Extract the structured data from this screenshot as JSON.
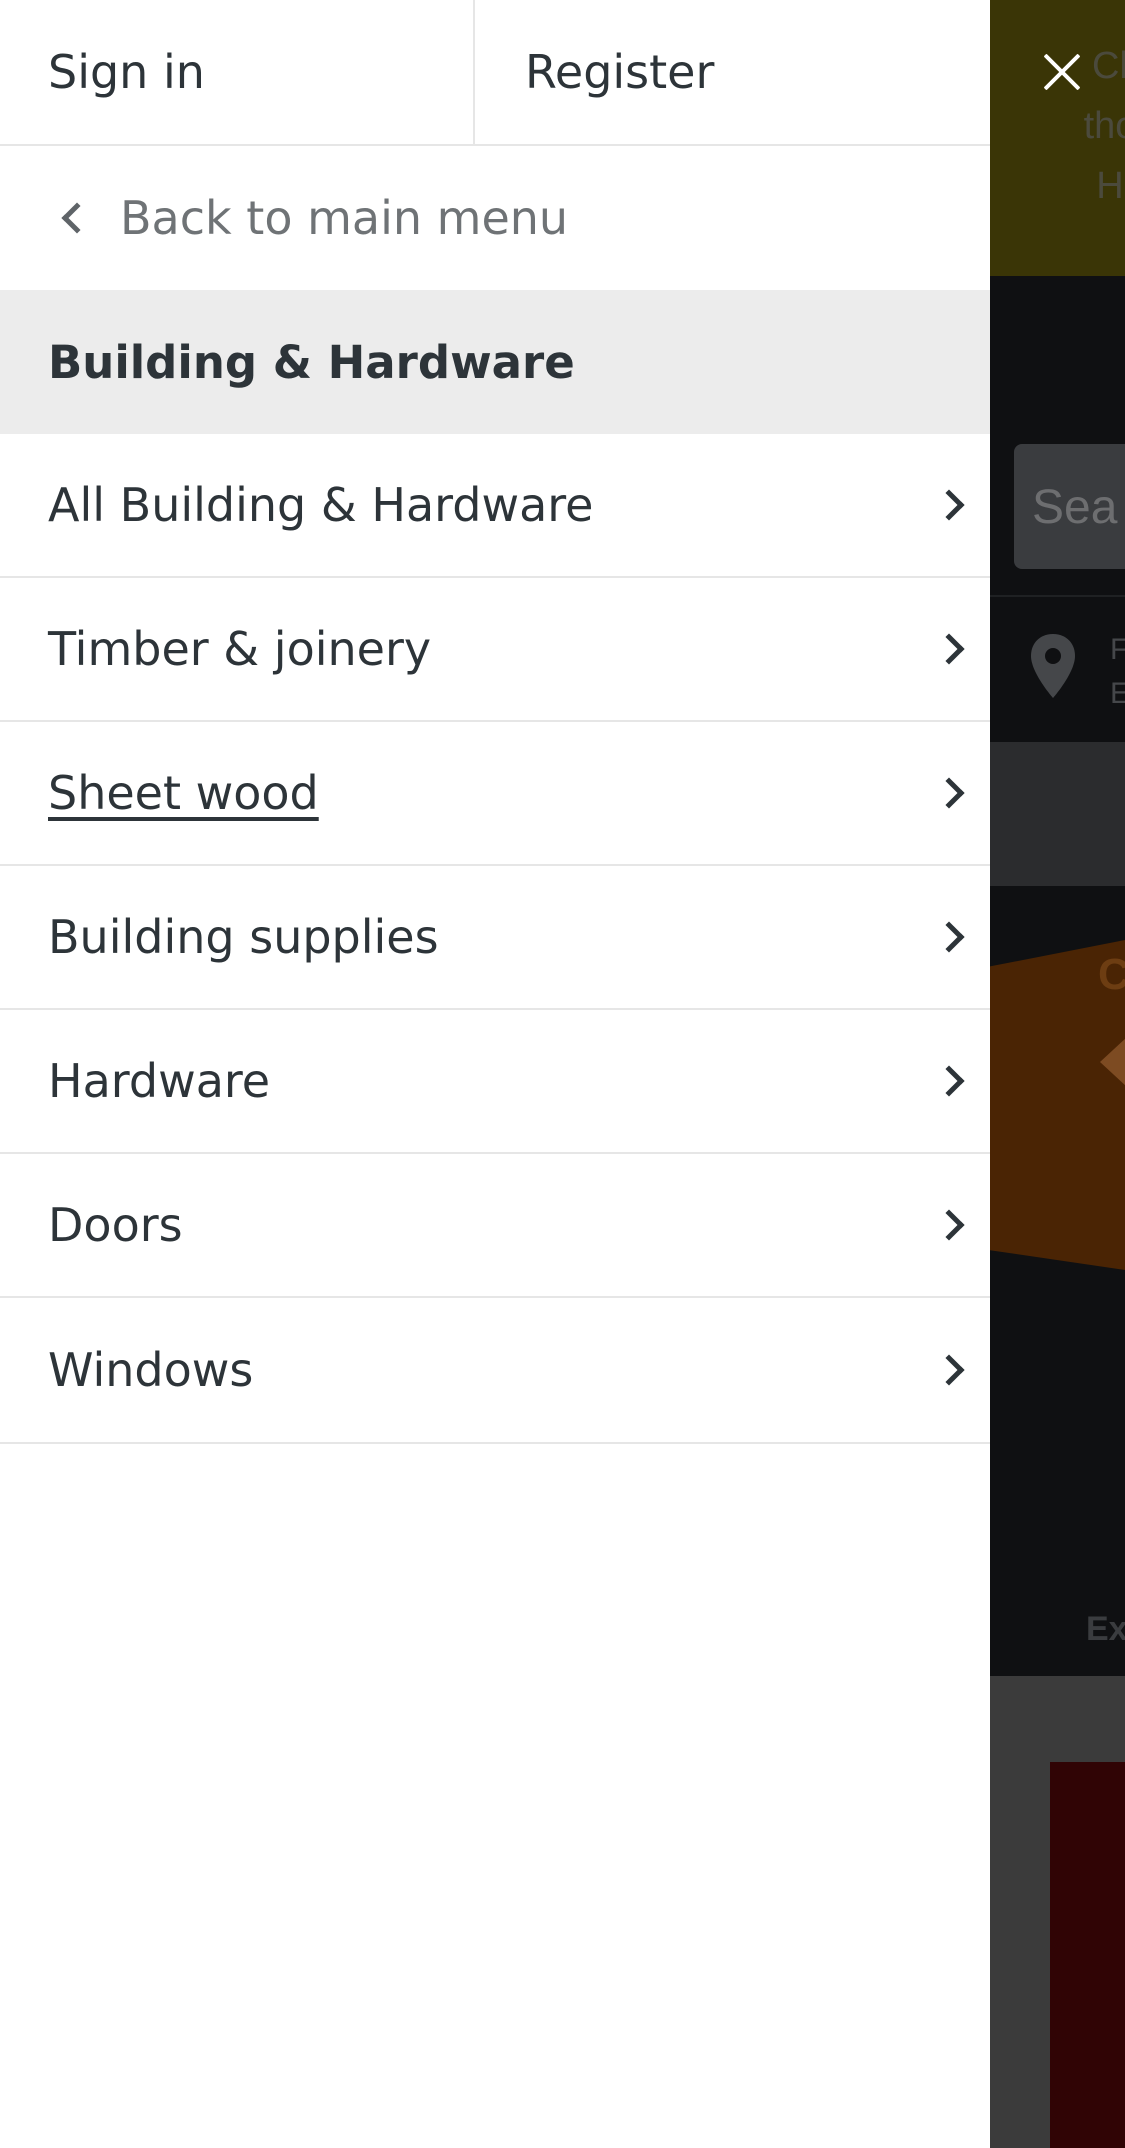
{
  "header": {
    "sign_in": "Sign in",
    "register": "Register"
  },
  "navigation": {
    "back_label": "Back to main menu",
    "section_title": "Building & Hardware"
  },
  "menu": {
    "items": [
      {
        "label": "All Building & Hardware",
        "icon": "chevron-right-icon",
        "underlined": false
      },
      {
        "label": "Timber & joinery",
        "icon": "chevron-right-icon",
        "underlined": false
      },
      {
        "label": "Sheet wood",
        "icon": "chevron-right-icon",
        "underlined": true
      },
      {
        "label": "Building supplies",
        "icon": "chevron-right-icon",
        "underlined": false
      },
      {
        "label": "Hardware",
        "icon": "chevron-right-icon",
        "underlined": false
      },
      {
        "label": "Doors",
        "icon": "chevron-right-icon",
        "underlined": false
      },
      {
        "label": "Windows",
        "icon": "chevron-right-icon",
        "underlined": false
      }
    ]
  },
  "background": {
    "banner_text": "Cl tho H",
    "search_placeholder": "Sea",
    "store_text": "F E",
    "promo_letter": "C",
    "footer_text": "Ex"
  },
  "icons": {
    "close": "close-icon",
    "back": "chevron-left-icon",
    "location": "map-pin-icon"
  },
  "colors": {
    "text": "#2d3439",
    "muted_text": "#6f7376",
    "section_bg": "#ececec",
    "divider": "#e6e6e6",
    "overlay_banner": "#3a3506"
  }
}
